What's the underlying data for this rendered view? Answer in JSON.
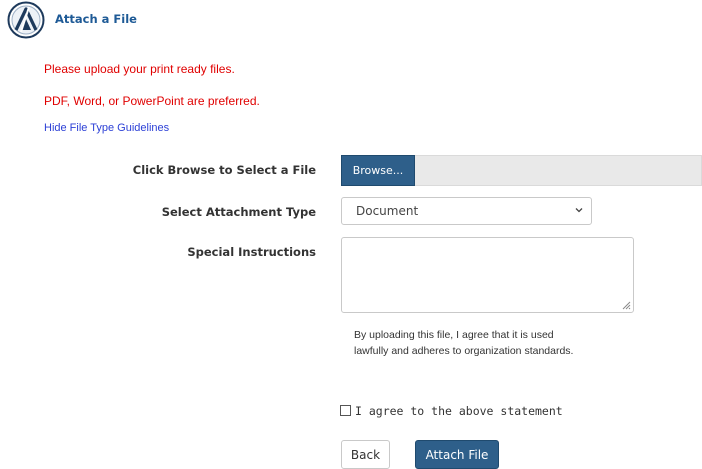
{
  "header": {
    "title": "Attach a File",
    "logo_icon": "attach-logo-icon"
  },
  "notes": {
    "line1": "Please upload your print ready files.",
    "line2": "PDF, Word, or PowerPoint are preferred.",
    "toggle_link": "Hide File Type Guidelines"
  },
  "form": {
    "browse_label": "Click Browse to Select a File",
    "browse_button": "Browse...",
    "type_label": "Select Attachment Type",
    "type_value": "Document",
    "instructions_label": "Special Instructions",
    "instructions_value": "",
    "agreement_text": "By uploading this file, I agree that it is used lawfully and adheres to organization standards.",
    "agree_label": "I agree to the above statement",
    "agree_checked": false
  },
  "actions": {
    "back": "Back",
    "attach": "Attach File"
  },
  "colors": {
    "brand": "#1e5a96",
    "button": "#2e5f8a",
    "warning": "#e00000",
    "link": "#2b3fd6"
  }
}
